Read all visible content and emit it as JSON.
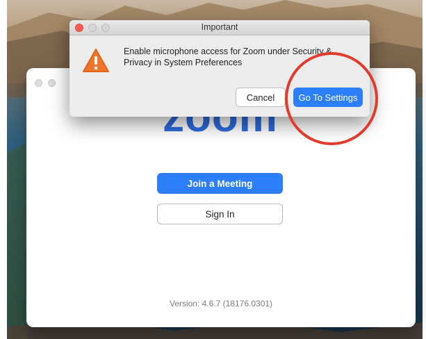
{
  "dialog": {
    "title": "Important",
    "message": "Enable microphone access for Zoom under Security & Privacy in System Preferences",
    "cancel_label": "Cancel",
    "go_to_settings_label": "Go To Settings",
    "icon": "warning-triangle-icon"
  },
  "zoom": {
    "logo_text": "zoom",
    "join_label": "Join a Meeting",
    "sign_in_label": "Sign In",
    "version_text": "Version: 4.6.7 (18176.0301)"
  },
  "colors": {
    "accent": "#2d7ff9",
    "logo": "#2d6cdf",
    "warning": "#f0742a",
    "annotation": "#e23b2e",
    "close": "#fc5d57"
  }
}
